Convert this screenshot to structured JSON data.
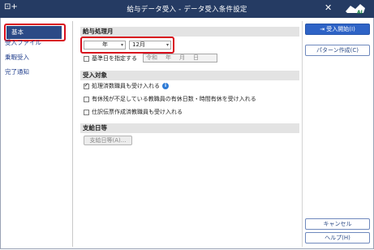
{
  "window": {
    "title": "給与データ受入 - データ受入条件設定",
    "app_icon": "window-new-icon",
    "close_icon": "close-icon",
    "logo_text": "AI"
  },
  "sidebar": {
    "items": [
      {
        "label": "基本",
        "selected": true
      },
      {
        "label": "受入ファイル",
        "selected": false
      },
      {
        "label": "乗暇受入",
        "selected": false
      },
      {
        "label": "完了通知",
        "selected": false
      }
    ]
  },
  "main": {
    "pay_month": {
      "heading": "給与処理月",
      "year_value": "",
      "year_unit": "年",
      "month_value": "12月",
      "base_date_label": "基準日を指定する",
      "base_date_checked": false,
      "date_era": "令和",
      "date_year": "年",
      "date_month": "月",
      "date_day": "日"
    },
    "targets": {
      "heading": "受入対象",
      "options": [
        {
          "label": "処理済数職員も受け入れる",
          "checked": true,
          "info": true
        },
        {
          "label": "有休残が不足している教職員の有休日数・時間有休を受け入れる",
          "checked": false
        },
        {
          "label": "仕訳伝票作成済教職員も受け入れる",
          "checked": false
        }
      ]
    },
    "payment_date": {
      "heading": "支給日等",
      "button_label": "支給日等(A)..."
    }
  },
  "actions": {
    "start_label": "受入開始(I)",
    "pattern_label": "パターン作成(C)",
    "cancel_label": "キャンセル",
    "help_label": "ヘルプ(H)"
  },
  "colors": {
    "titlebar": "#253b63",
    "selected": "#2b4a86",
    "highlight": "#d80e1c",
    "primary": "#2e63c6"
  }
}
